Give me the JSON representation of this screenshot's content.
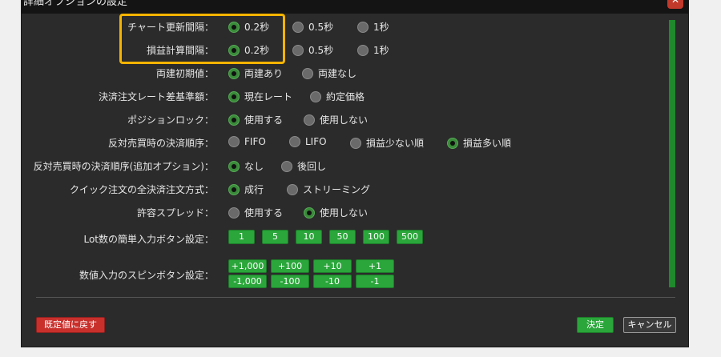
{
  "dialog": {
    "title": "詳細オプションの設定",
    "close_glyph": "✕"
  },
  "rows": [
    {
      "label": "チャート更新間隔：",
      "options": [
        "0.2秒",
        "0.5秒",
        "1秒"
      ],
      "selected": 0
    },
    {
      "label": "損益計算間隔：",
      "options": [
        "0.2秒",
        "0.5秒",
        "1秒"
      ],
      "selected": 0
    },
    {
      "label": "両建初期値：",
      "options": [
        "両建あり",
        "両建なし"
      ],
      "selected": 0
    },
    {
      "label": "決済注文レート差基準額：",
      "options": [
        "現在レート",
        "約定価格"
      ],
      "selected": 0
    },
    {
      "label": "ポジションロック：",
      "options": [
        "使用する",
        "使用しない"
      ],
      "selected": 0
    },
    {
      "label": "反対売買時の決済順序：",
      "options": [
        "FIFO",
        "LIFO",
        "損益少ない順",
        "損益多い順"
      ],
      "selected": 3
    },
    {
      "label": "反対売買時の決済順序(追加オプション)：",
      "options": [
        "なし",
        "後回し"
      ],
      "selected": 0
    },
    {
      "label": "クイック注文の全決済注文方式：",
      "options": [
        "成行",
        "ストリーミング"
      ],
      "selected": 0
    },
    {
      "label": "許容スプレッド：",
      "options": [
        "使用する",
        "使用しない"
      ],
      "selected": 1
    }
  ],
  "lot": {
    "label": "Lot数の簡単入力ボタン設定：",
    "buttons": [
      "1",
      "5",
      "10",
      "50",
      "100",
      "500"
    ]
  },
  "spin": {
    "label": "数値入力のスピンボタン設定：",
    "up": [
      "+1,000",
      "+100",
      "+10",
      "+1"
    ],
    "down": [
      "-1,000",
      "-100",
      "-10",
      "-1"
    ]
  },
  "footer": {
    "reset_label": "既定値に戻す",
    "ok_label": "決定",
    "cancel_label": "キャンセル"
  },
  "colors": {
    "highlight": "#f4b400",
    "accent_green": "#2aa63a",
    "danger_red": "#c9302c"
  }
}
